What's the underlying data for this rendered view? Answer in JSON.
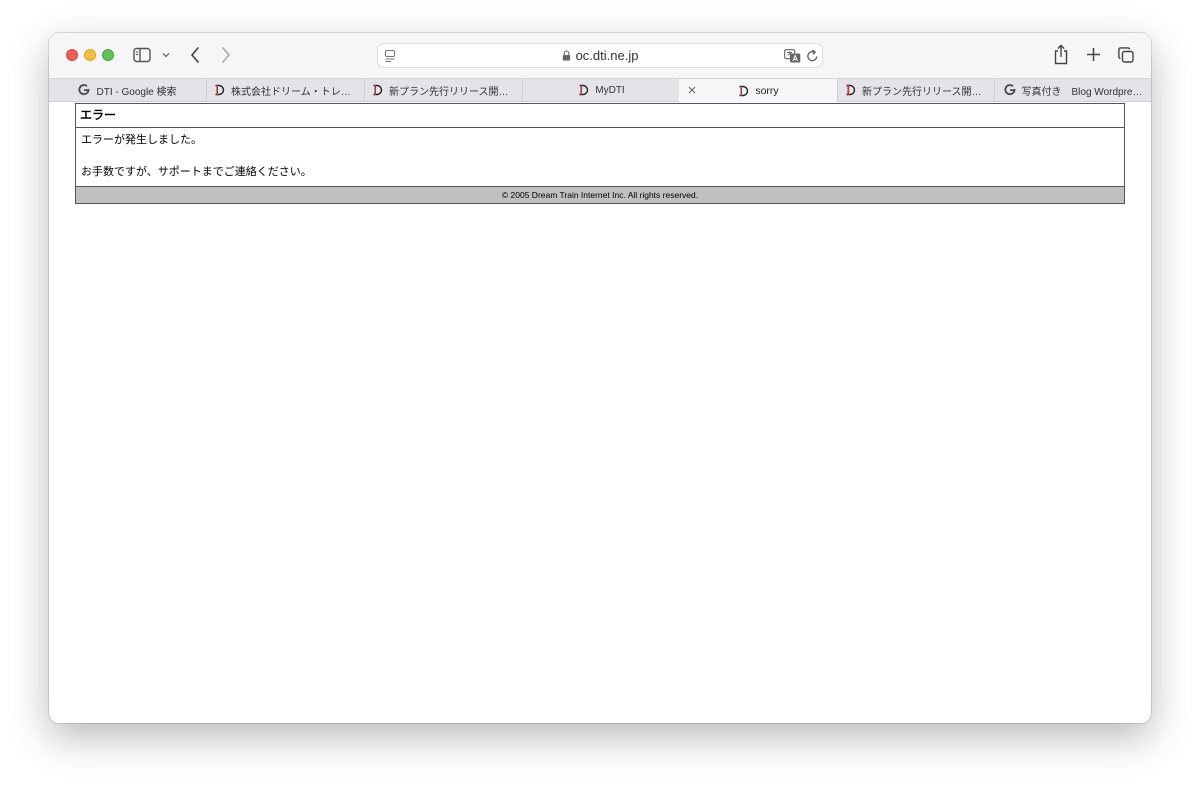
{
  "browser": {
    "url": "oc.dti.ne.jp"
  },
  "tabs": [
    {
      "label": "DTI - Google 検索",
      "favicon": "google-icon"
    },
    {
      "label": "株式会社ドリーム・トレイ…",
      "favicon": "dti-icon"
    },
    {
      "label": "新プラン先行リリース開始…",
      "favicon": "dti-icon"
    },
    {
      "label": "MyDTI",
      "favicon": "dti-icon"
    },
    {
      "label": "sorry",
      "favicon": "dti-icon",
      "active": true
    },
    {
      "label": "新プラン先行リリース開始…",
      "favicon": "dti-icon"
    },
    {
      "label": "写真付き　Blog Wordpre…",
      "favicon": "google-icon"
    }
  ],
  "page": {
    "title": "エラー",
    "line1": "エラーが発生しました。",
    "line2": "お手数ですが、サポートまでご連絡ください。",
    "footer": "© 2005 Dream Train Internet Inc. All rights reserved."
  },
  "colors": {
    "footer_bg": "#c0c0c0",
    "border": "#555555",
    "toolbar_bg": "#f6f6f8",
    "tabstrip_bg": "#e3e3e8"
  }
}
